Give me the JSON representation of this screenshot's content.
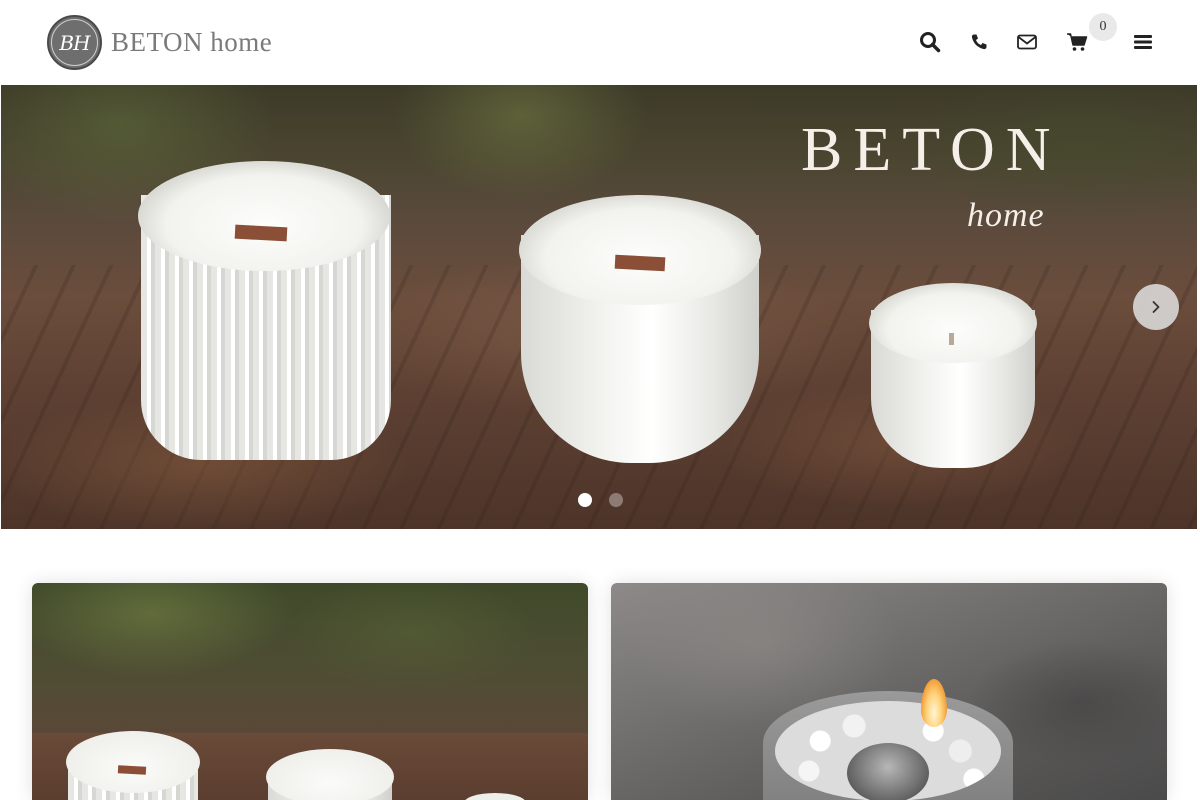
{
  "header": {
    "logo_monogram": "BH",
    "logo_text": "BETON home",
    "icons": [
      "search-icon",
      "phone-icon",
      "mail-icon",
      "cart-icon",
      "menu-icon"
    ],
    "cart_count": "0"
  },
  "hero": {
    "brand_title": "BETON",
    "brand_subtitle": "home",
    "slides_total": 2,
    "active_slide": 1
  },
  "colors": {
    "icon": "#222222",
    "logo_text": "#7a7a7a",
    "badge_bg": "#e9e9e9"
  }
}
